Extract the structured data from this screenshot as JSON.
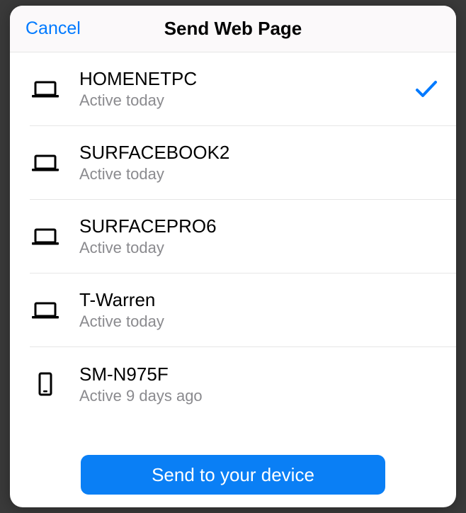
{
  "header": {
    "cancel_label": "Cancel",
    "title": "Send Web Page"
  },
  "devices": [
    {
      "name": "HOMENETPC",
      "status": "Active today",
      "type": "laptop",
      "selected": true
    },
    {
      "name": "SURFACEBOOK2",
      "status": "Active today",
      "type": "laptop",
      "selected": false
    },
    {
      "name": "SURFACEPRO6",
      "status": "Active today",
      "type": "laptop",
      "selected": false
    },
    {
      "name": "T-Warren",
      "status": "Active today",
      "type": "laptop",
      "selected": false
    },
    {
      "name": "SM-N975F",
      "status": "Active 9 days ago",
      "type": "phone",
      "selected": false
    }
  ],
  "footer": {
    "send_label": "Send to your device"
  },
  "colors": {
    "accent": "#007aff",
    "button": "#0a7ff5",
    "subtext": "#8a8a8e"
  }
}
